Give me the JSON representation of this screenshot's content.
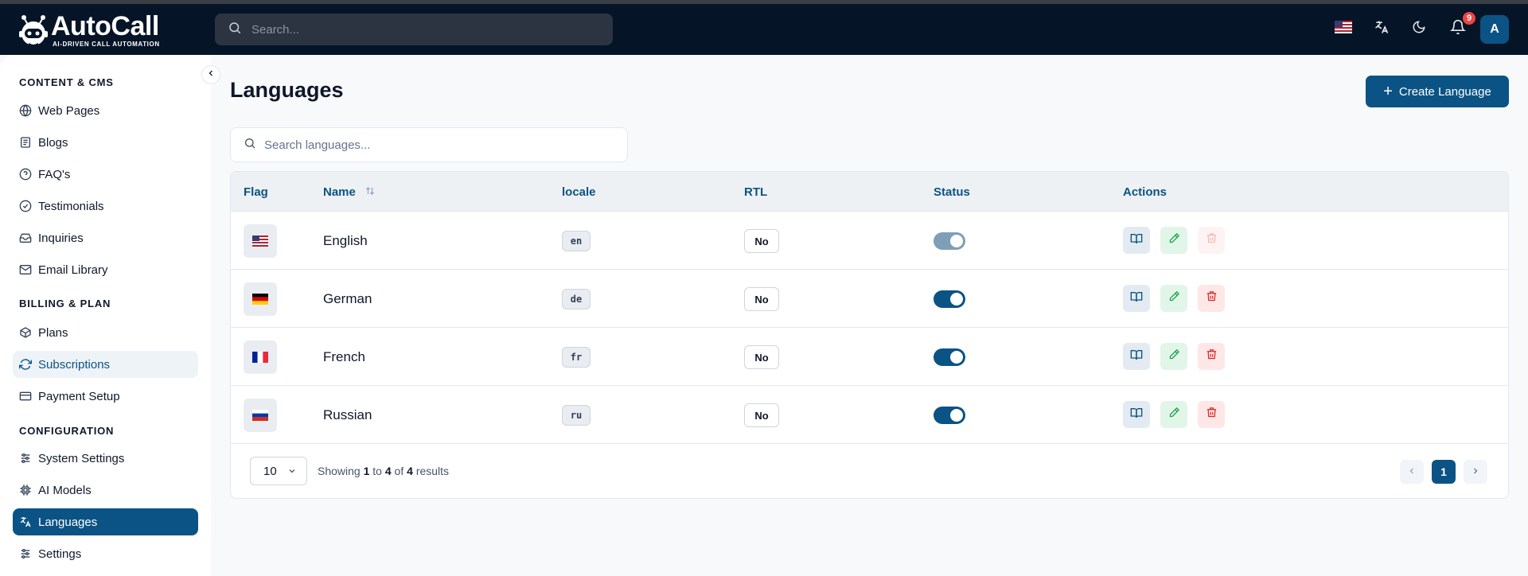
{
  "app": {
    "logo_main": "AutoCall",
    "logo_tagline": "AI-DRIVEN CALL AUTOMATION"
  },
  "topbar": {
    "search_placeholder": "Search...",
    "notifications_count": "9",
    "avatar_initial": "A"
  },
  "sidebar": {
    "sections": [
      {
        "title": "CONTENT & CMS",
        "items": [
          {
            "label": "Web Pages",
            "icon": "globe-icon"
          },
          {
            "label": "Blogs",
            "icon": "newspaper-icon"
          },
          {
            "label": "FAQ's",
            "icon": "help-circle-icon"
          },
          {
            "label": "Testimonials",
            "icon": "check-circle-icon"
          },
          {
            "label": "Inquiries",
            "icon": "inbox-icon"
          },
          {
            "label": "Email Library",
            "icon": "mail-icon"
          }
        ]
      },
      {
        "title": "BILLING & PLAN",
        "items": [
          {
            "label": "Plans",
            "icon": "package-icon"
          },
          {
            "label": "Subscriptions",
            "icon": "refresh-icon"
          },
          {
            "label": "Payment Setup",
            "icon": "credit-card-icon"
          }
        ]
      },
      {
        "title": "CONFIGURATION",
        "items": [
          {
            "label": "System Settings",
            "icon": "sliders-icon"
          },
          {
            "label": "AI Models",
            "icon": "chip-icon"
          },
          {
            "label": "Languages",
            "icon": "translate-icon"
          },
          {
            "label": "Settings",
            "icon": "sliders-icon"
          }
        ]
      }
    ]
  },
  "page": {
    "title": "Languages",
    "create_label": "Create Language",
    "search_placeholder": "Search languages..."
  },
  "table": {
    "headers": {
      "flag": "Flag",
      "name": "Name",
      "locale": "locale",
      "rtl": "RTL",
      "status": "Status",
      "actions": "Actions"
    },
    "rows": [
      {
        "name": "English",
        "locale": "en",
        "rtl": "No",
        "status": "enabled",
        "toggle_disabled": true,
        "delete_disabled": true,
        "flag": "us"
      },
      {
        "name": "German",
        "locale": "de",
        "rtl": "No",
        "status": "enabled",
        "toggle_disabled": false,
        "delete_disabled": false,
        "flag": "de"
      },
      {
        "name": "French",
        "locale": "fr",
        "rtl": "No",
        "status": "enabled",
        "toggle_disabled": false,
        "delete_disabled": false,
        "flag": "fr"
      },
      {
        "name": "Russian",
        "locale": "ru",
        "rtl": "No",
        "status": "enabled",
        "toggle_disabled": false,
        "delete_disabled": false,
        "flag": "ru"
      }
    ]
  },
  "pagination": {
    "per_page": "10",
    "showing_prefix": "Showing",
    "from": "1",
    "to_word": "to",
    "to": "4",
    "of_word": "of",
    "total": "4",
    "results_word": "results",
    "current_page": "1"
  },
  "colors": {
    "brand": "#0b5384",
    "topbar": "#061427",
    "danger": "#dc2626",
    "success": "#16a34a"
  }
}
